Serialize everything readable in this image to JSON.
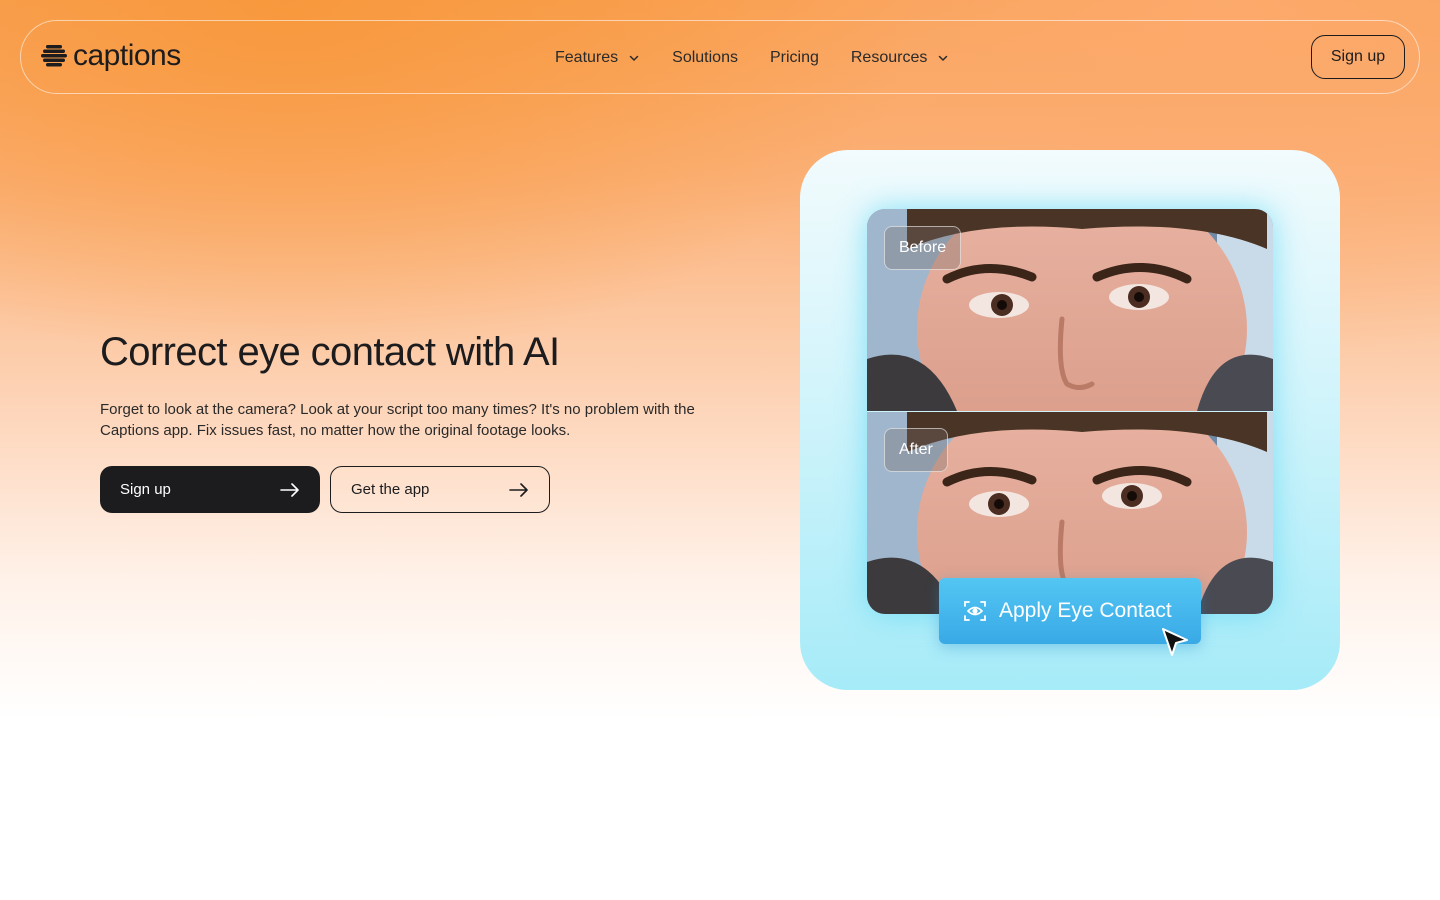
{
  "nav": {
    "logo_text": "captions",
    "links": [
      {
        "label": "Features",
        "has_dropdown": true
      },
      {
        "label": "Solutions",
        "has_dropdown": false
      },
      {
        "label": "Pricing",
        "has_dropdown": false
      },
      {
        "label": "Resources",
        "has_dropdown": true
      }
    ],
    "signup_label": "Sign up"
  },
  "hero": {
    "title": "Correct eye contact with AI",
    "subtitle": "Forget to look at the camera? Look at your script too many times? It's no problem with the Captions app. Fix issues fast, no matter how the original footage looks.",
    "primary_button": "Sign up",
    "secondary_button": "Get the app"
  },
  "demo": {
    "before_label": "Before",
    "after_label": "After",
    "apply_label": "Apply Eye Contact"
  },
  "icons": {
    "logo": "captions-logo-icon",
    "dropdown": "chevron-down-icon",
    "arrow": "arrow-right-icon",
    "eye": "eye-scan-icon",
    "cursor": "mouse-pointer-icon"
  },
  "colors": {
    "accent_orange": "#f9a256",
    "dark": "#1c1c1e",
    "card_cyan": "#a6ebf8",
    "apply_blue": "#39a9e6"
  }
}
